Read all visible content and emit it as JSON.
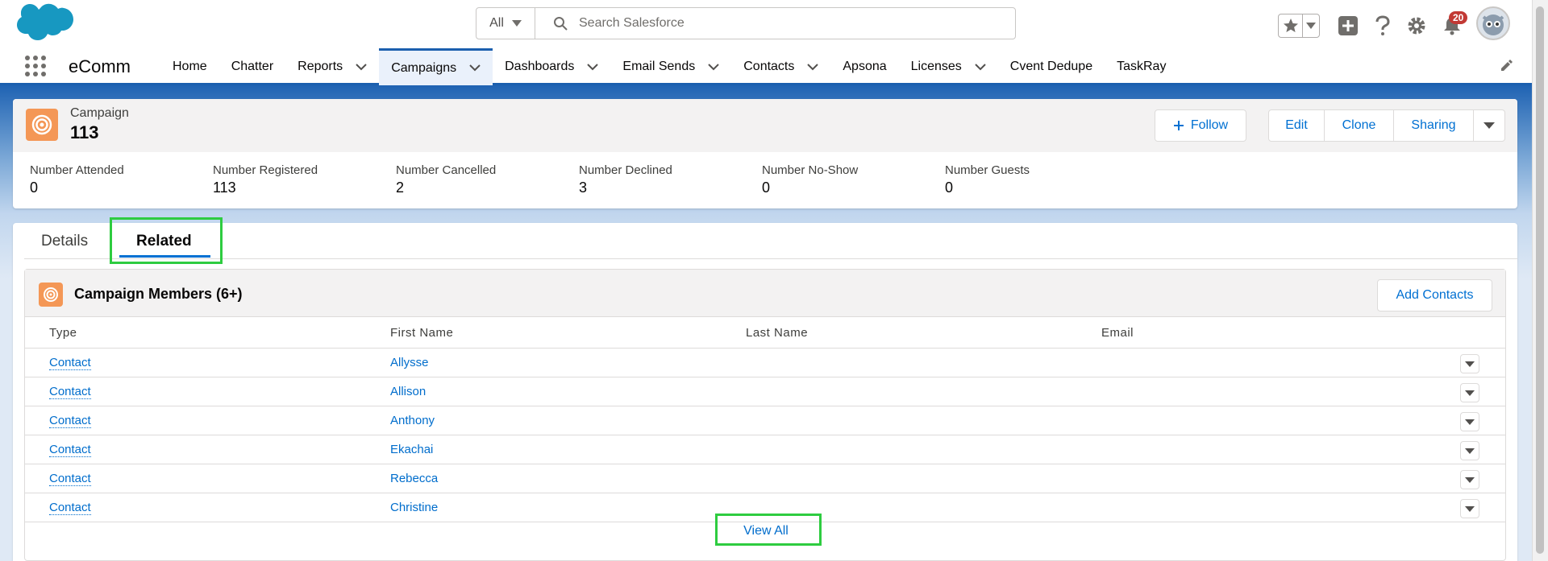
{
  "header": {
    "search_scope": "All",
    "search_placeholder": "Search Salesforce",
    "notification_count": "20"
  },
  "nav": {
    "app_name": "eComm",
    "items": [
      {
        "label": "Home",
        "dropdown": false
      },
      {
        "label": "Chatter",
        "dropdown": false
      },
      {
        "label": "Reports",
        "dropdown": true
      },
      {
        "label": "Campaigns",
        "dropdown": true,
        "active": true
      },
      {
        "label": "Dashboards",
        "dropdown": true
      },
      {
        "label": "Email Sends",
        "dropdown": true
      },
      {
        "label": "Contacts",
        "dropdown": true
      },
      {
        "label": "Apsona",
        "dropdown": false
      },
      {
        "label": "Licenses",
        "dropdown": true
      },
      {
        "label": "Cvent Dedupe",
        "dropdown": false
      },
      {
        "label": "TaskRay",
        "dropdown": false
      }
    ]
  },
  "record": {
    "type": "Campaign",
    "title": "113",
    "follow_label": "Follow",
    "actions": [
      "Edit",
      "Clone",
      "Sharing"
    ],
    "highlights": [
      {
        "label": "Number Attended",
        "value": "0"
      },
      {
        "label": "Number Registered",
        "value": "113"
      },
      {
        "label": "Number Cancelled",
        "value": "2"
      },
      {
        "label": "Number Declined",
        "value": "3"
      },
      {
        "label": "Number No-Show",
        "value": "0"
      },
      {
        "label": "Number Guests",
        "value": "0"
      }
    ]
  },
  "tabs": {
    "details": "Details",
    "related": "Related"
  },
  "related_list": {
    "title": "Campaign Members (6+)",
    "add_button": "Add Contacts",
    "columns": [
      "Type",
      "First Name",
      "Last Name",
      "Email"
    ],
    "rows": [
      {
        "type": "Contact",
        "first_name": "Allysse"
      },
      {
        "type": "Contact",
        "first_name": "Allison"
      },
      {
        "type": "Contact",
        "first_name": "Anthony"
      },
      {
        "type": "Contact",
        "first_name": "Ekachai"
      },
      {
        "type": "Contact",
        "first_name": "Rebecca"
      },
      {
        "type": "Contact",
        "first_name": "Christine"
      }
    ],
    "view_all": "View All"
  },
  "colors": {
    "brand_blue": "#1b5fae",
    "link_blue": "#006dcc",
    "campaign_orange": "#f49756",
    "highlight_green": "#2ecc40"
  }
}
